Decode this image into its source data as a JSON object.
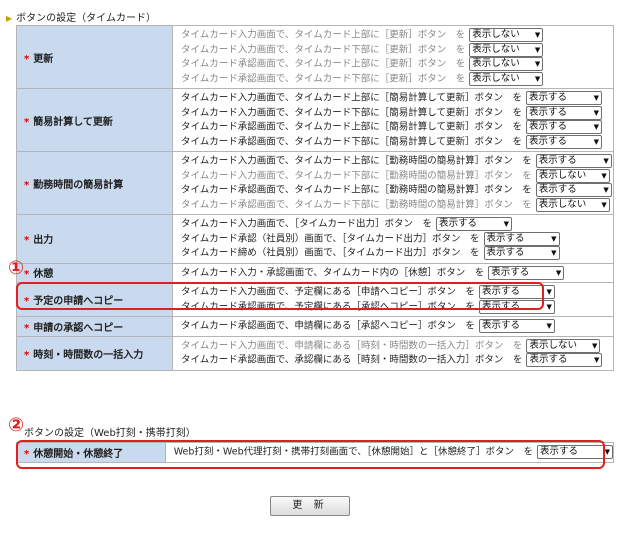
{
  "section1": {
    "title": "ボタンの設定（タイムカード）",
    "rows": [
      {
        "label": "更新",
        "lines": [
          {
            "text": "タイムカード入力画面で、タイムカード上部に［更新］ボタン　を",
            "value": "表示しない",
            "gray": true
          },
          {
            "text": "タイムカード入力画面で、タイムカード下部に［更新］ボタン　を",
            "value": "表示しない",
            "gray": true
          },
          {
            "text": "タイムカード承認画面で、タイムカード上部に［更新］ボタン　を",
            "value": "表示しない",
            "gray": true
          },
          {
            "text": "タイムカード承認画面で、タイムカード下部に［更新］ボタン　を",
            "value": "表示しない",
            "gray": true
          }
        ]
      },
      {
        "label": "簡易計算して更新",
        "lines": [
          {
            "text": "タイムカード入力画面で、タイムカード上部に［簡易計算して更新］ボタン　を",
            "value": "表示する",
            "gray": false
          },
          {
            "text": "タイムカード入力画面で、タイムカード下部に［簡易計算して更新］ボタン　を",
            "value": "表示する",
            "gray": false
          },
          {
            "text": "タイムカード承認画面で、タイムカード上部に［簡易計算して更新］ボタン　を",
            "value": "表示する",
            "gray": false
          },
          {
            "text": "タイムカード承認画面で、タイムカード下部に［簡易計算して更新］ボタン　を",
            "value": "表示する",
            "gray": false
          }
        ]
      },
      {
        "label": "勤務時間の簡易計算",
        "lines": [
          {
            "text": "タイムカード入力画面で、タイムカード上部に［勤務時間の簡易計算］ボタン　を",
            "value": "表示する",
            "gray": false
          },
          {
            "text": "タイムカード入力画面で、タイムカード下部に［勤務時間の簡易計算］ボタン　を",
            "value": "表示しない",
            "gray": true
          },
          {
            "text": "タイムカード承認画面で、タイムカード上部に［勤務時間の簡易計算］ボタン　を",
            "value": "表示する",
            "gray": false
          },
          {
            "text": "タイムカード承認画面で、タイムカード下部に［勤務時間の簡易計算］ボタン　を",
            "value": "表示しない",
            "gray": true
          }
        ]
      },
      {
        "label": "出力",
        "lines": [
          {
            "text": "タイムカード入力画面で、［タイムカード出力］ボタン　を",
            "value": "表示する",
            "gray": false
          },
          {
            "text": "タイムカード承認（社員別）画面で、［タイムカード出力］ボタン　を",
            "value": "表示する",
            "gray": false
          },
          {
            "text": "タイムカード締め（社員別）画面で、［タイムカード出力］ボタン　を",
            "value": "表示する",
            "gray": false
          }
        ]
      },
      {
        "label": "休憩",
        "lines": [
          {
            "text": "タイムカード入力・承認画面で、タイムカード内の［休憩］ボタン　を",
            "value": "表示する",
            "gray": false
          }
        ]
      },
      {
        "label": "予定の申請へコピー",
        "lines": [
          {
            "text": "タイムカード入力画面で、予定欄にある［申請へコピー］ボタン　を",
            "value": "表示する",
            "gray": false
          },
          {
            "text": "タイムカード承認画面で、予定欄にある［承認へコピー］ボタン　を",
            "value": "表示する",
            "gray": false
          }
        ]
      },
      {
        "label": "申請の承認へコピー",
        "lines": [
          {
            "text": "タイムカード承認画面で、申請欄にある［承認へコピー］ボタン　を",
            "value": "表示する",
            "gray": false
          }
        ]
      },
      {
        "label": "時刻・時間数の一括入力",
        "lines": [
          {
            "text": "タイムカード入力画面で、申請欄にある［時刻・時間数の一括入力］ボタン　を",
            "value": "表示しない",
            "gray": true
          },
          {
            "text": "タイムカード承認画面で、承認欄にある［時刻・時間数の一括入力］ボタン　を",
            "value": "表示する",
            "gray": false
          }
        ]
      }
    ]
  },
  "section2": {
    "title": "ボタンの設定（Web打刻・携帯打刻）",
    "rows": [
      {
        "label": "休憩開始・休憩終了",
        "lines": [
          {
            "text": "Web打刻・Web代理打刻・携帯打刻画面で、［休憩開始］と［休憩終了］ボタン　を",
            "value": "表示する",
            "gray": false
          }
        ]
      }
    ]
  },
  "annotations": {
    "one": "①",
    "two": "②"
  },
  "update_button": "更 新",
  "colors": {
    "label_bg": "#c9d9ee",
    "required_star": "#e00000",
    "annotation": "#e02020"
  }
}
